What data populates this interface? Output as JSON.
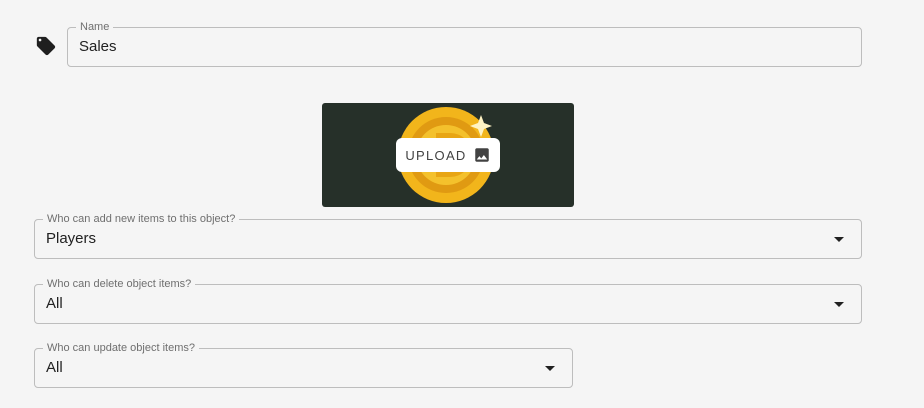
{
  "name_field": {
    "label": "Name",
    "value": "Sales",
    "icon": "tag-icon"
  },
  "image_upload": {
    "button_label": "UPLOAD",
    "icon": "image-icon",
    "background_color": "#263029",
    "coin_color": "#f2b51b"
  },
  "permissions": {
    "add": {
      "label": "Who can add new items to this object?",
      "value": "Players"
    },
    "delete": {
      "label": "Who can delete object items?",
      "value": "All"
    },
    "update": {
      "label": "Who can update object items?",
      "value": "All"
    }
  }
}
